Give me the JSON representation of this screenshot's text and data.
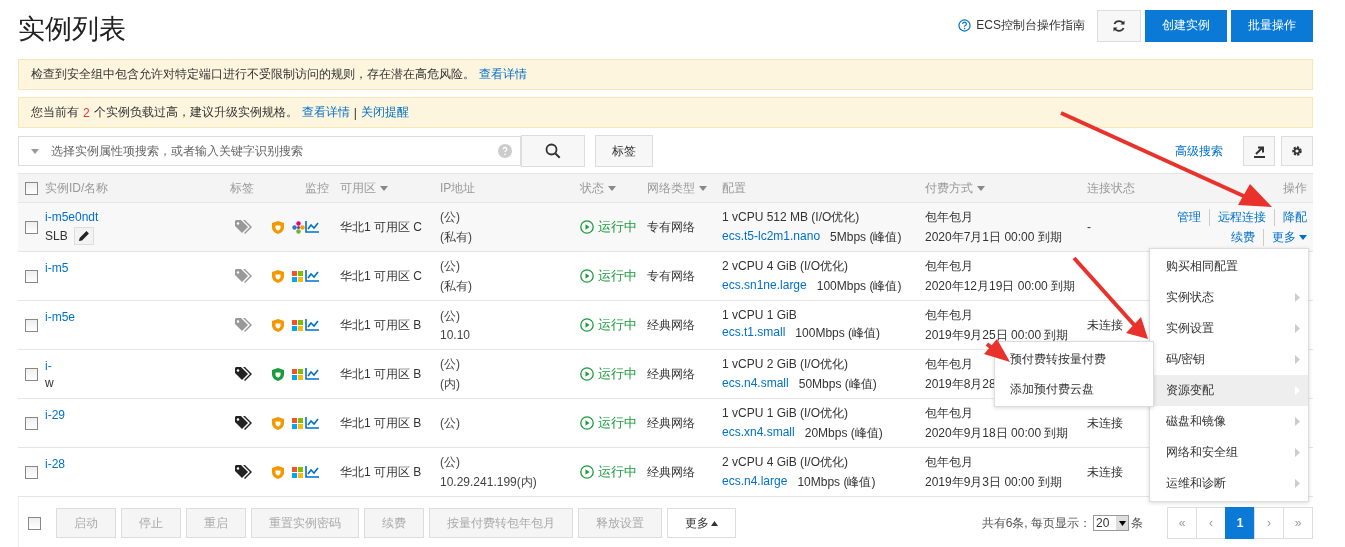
{
  "title": "实例列表",
  "guide_link": "ECS控制台操作指南",
  "top_buttons": [
    {
      "label": "创建实例",
      "kind": "primary"
    },
    {
      "label": "批量操作",
      "kind": "primary"
    }
  ],
  "alerts": [
    {
      "segments": [
        {
          "kind": "text",
          "text": "检查到安全组中包含允许对特定端口进行不受限制访问的规则，存在潜在高危风险。"
        },
        {
          "kind": "link",
          "text": "查看详情"
        }
      ]
    },
    {
      "segments": [
        {
          "kind": "text",
          "text": "您当前有"
        },
        {
          "kind": "highlight",
          "text": "2"
        },
        {
          "kind": "text",
          "text": "个实例负载过高，建议升级实例规格。"
        },
        {
          "kind": "link",
          "text": "查看详情"
        },
        {
          "kind": "text",
          "text": "|"
        },
        {
          "kind": "link",
          "text": "关闭提醒"
        }
      ]
    }
  ],
  "search": {
    "placeholder": "选择实例属性项搜索，或者输入关键字识别搜索"
  },
  "tag_button": "标签",
  "advanced_search": "高级搜索",
  "table": {
    "header_checked": false,
    "columns": [
      {
        "label": "实例ID/名称",
        "sortable": false
      },
      {
        "label": "标签",
        "sortable": false
      },
      {
        "label": "监控",
        "sortable": false
      },
      {
        "label": "可用区",
        "sortable": true
      },
      {
        "label": "IP地址",
        "sortable": false
      },
      {
        "label": "状态",
        "sortable": true
      },
      {
        "label": "网络类型",
        "sortable": true
      },
      {
        "label": "配置",
        "sortable": false
      },
      {
        "label": "付费方式",
        "sortable": true
      },
      {
        "label": "连接状态",
        "sortable": false
      },
      {
        "label": "操作",
        "sortable": false
      }
    ],
    "rows": [
      {
        "checked": false,
        "hovered": true,
        "id": "i-m5e0ndt",
        "name": "SLB",
        "name_editable": true,
        "tagged": false,
        "shield": {
          "color": "#f39800"
        },
        "os": {
          "kind": "flower"
        },
        "zone": "华北1 可用区 C",
        "ip_public": "(公)",
        "ip_private": "(私有)",
        "status": "运行中",
        "network": "专有网络",
        "config": "1 vCPU 512 MB (I/O优化)",
        "spec": "ecs.t5-lc2m1.nano",
        "bandwidth": "5Mbps (峰值)",
        "billing": "包年包月",
        "expiry": "2020年7月1日 00:00 到期",
        "connection": "-",
        "actions": [
          [
            {
              "label": "管理",
              "dropdown": false
            },
            {
              "label": "远程连接",
              "dropdown": false
            },
            {
              "label": "降配",
              "dropdown": false
            }
          ],
          [
            {
              "label": "续费",
              "dropdown": false
            },
            {
              "label": "更多",
              "dropdown": true
            }
          ]
        ]
      },
      {
        "checked": false,
        "hovered": false,
        "id": "i-m5",
        "name_editable": false,
        "tagged": false,
        "shield": {
          "color": "#f39800"
        },
        "os": {
          "kind": "windows"
        },
        "zone": "华北1 可用区 C",
        "ip_public": "(公)",
        "ip_private": "(私有)",
        "status": "运行中",
        "network": "专有网络",
        "config": "2 vCPU 4 GiB (I/O优化)",
        "spec": "ecs.sn1ne.large",
        "bandwidth": "100Mbps (峰值)",
        "billing": "包年包月",
        "expiry": "2020年12月19日 00:00 到期"
      },
      {
        "checked": false,
        "hovered": false,
        "id": "i-m5e",
        "name_editable": false,
        "tagged": false,
        "shield": {
          "color": "#f39800"
        },
        "os": {
          "kind": "windows"
        },
        "zone": "华北1 可用区 B",
        "ip_public": "(公)",
        "ip_private": "10.10",
        "status": "运行中",
        "network": "经典网络",
        "config": "1 vCPU 1 GiB",
        "spec": "ecs.t1.small",
        "bandwidth": "100Mbps (峰值)",
        "billing": "包年包月",
        "expiry": "2019年9月25日 00:00 到期",
        "connection": "未连接"
      },
      {
        "checked": false,
        "hovered": false,
        "id": "i-",
        "name": "w",
        "name_editable": false,
        "tagged": true,
        "shield": {
          "color": "#1a9b3c"
        },
        "os": {
          "kind": "windows"
        },
        "zone": "华北1 可用区 B",
        "ip_public": "(公)",
        "ip_private": "(内)",
        "status": "运行中",
        "network": "经典网络",
        "config": "1 vCPU 2 GiB (I/O优化)",
        "spec": "ecs.n4.small",
        "bandwidth": "50Mbps (峰值)",
        "billing": "包年包月",
        "expiry": "2019年8月28"
      },
      {
        "checked": false,
        "hovered": false,
        "id": "i-29",
        "name_editable": false,
        "tagged": true,
        "shield": {
          "color": "#f39800"
        },
        "os": {
          "kind": "windows"
        },
        "zone": "华北1 可用区 B",
        "ip_public": "(公)",
        "status": "运行中",
        "network": "经典网络",
        "config": "1 vCPU 1 GiB (I/O优化)",
        "spec": "ecs.xn4.small",
        "bandwidth": "20Mbps (峰值)",
        "billing": "包年包月",
        "expiry": "2020年9月18日 00:00 到期",
        "connection": "未连接"
      },
      {
        "checked": false,
        "hovered": false,
        "id": "i-28",
        "name_editable": false,
        "tagged": true,
        "shield": {
          "color": "#f39800"
        },
        "os": {
          "kind": "windows"
        },
        "zone": "华北1 可用区 B",
        "ip_public": "(公)",
        "ip_private": "10.29.241.199(内)",
        "status": "运行中",
        "network": "经典网络",
        "config": "2 vCPU 4 GiB (I/O优化)",
        "spec": "ecs.n4.large",
        "bandwidth": "10Mbps (峰值)",
        "billing": "包年包月",
        "expiry": "2019年9月3日 00:00 到期",
        "connection": "未连接"
      }
    ]
  },
  "menu": {
    "items": [
      {
        "label": "购买相同配置",
        "submenu": false,
        "selected": false
      },
      {
        "label": "实例状态",
        "submenu": true,
        "selected": false
      },
      {
        "label": "实例设置",
        "submenu": true,
        "selected": false
      },
      {
        "label": "码/密钥",
        "submenu": true,
        "selected": false
      },
      {
        "label": "资源变配",
        "submenu": true,
        "selected": true
      },
      {
        "label": "磁盘和镜像",
        "submenu": true,
        "selected": false
      },
      {
        "label": "网络和安全组",
        "submenu": true,
        "selected": false
      },
      {
        "label": "运维和诊断",
        "submenu": true,
        "selected": false
      }
    ],
    "submenu": [
      "预付费转按量付费",
      "添加预付费云盘"
    ]
  },
  "footer": {
    "checked": false,
    "buttons": [
      {
        "label": "启动",
        "disabled": true,
        "dropdown": false
      },
      {
        "label": "停止",
        "disabled": true,
        "dropdown": false
      },
      {
        "label": "重启",
        "disabled": true,
        "dropdown": false
      },
      {
        "label": "重置实例密码",
        "disabled": true,
        "dropdown": false
      },
      {
        "label": "续费",
        "disabled": true,
        "dropdown": false
      },
      {
        "label": "按量付费转包年包月",
        "disabled": true,
        "dropdown": false
      },
      {
        "label": "释放设置",
        "disabled": true,
        "dropdown": false
      },
      {
        "label": "更多",
        "disabled": false,
        "dropdown": true
      }
    ],
    "summary": "共有6条, 每页显示：",
    "page_size": "20",
    "unit": "条",
    "pager": [
      {
        "label": "«",
        "selected": false
      },
      {
        "label": "‹",
        "selected": false
      },
      {
        "label": "1",
        "selected": true
      },
      {
        "label": "›",
        "selected": false
      },
      {
        "label": "»",
        "selected": false
      }
    ]
  }
}
